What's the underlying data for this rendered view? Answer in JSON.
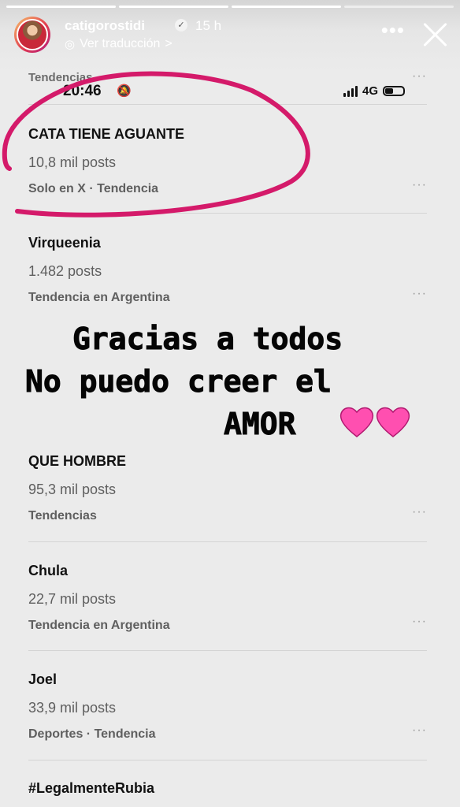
{
  "story": {
    "username": "catigorostidi",
    "time_ago": "15 h",
    "translate_label": "Ver traducción",
    "translate_chevron": ">",
    "more_icon": "more-horizontal-icon",
    "close_icon": "close-icon"
  },
  "statusbar": {
    "time": "20:46",
    "network": "4G",
    "silent_icon": "bell-slash-icon",
    "battery_fraction": 0.4
  },
  "x_trends": {
    "top_category": "Tendencias",
    "items": [
      {
        "name": "CATA TIENE AGUANTE",
        "count": "10,8 mil posts",
        "meta": "Solo en X · Tendencia"
      },
      {
        "name": "Virqueenia",
        "count": "1.482 posts",
        "meta": "Tendencia en Argentina"
      },
      {
        "name": "QUE HOMBRE",
        "count": "95,3 mil posts",
        "meta": "Tendencias"
      },
      {
        "name": "Chula",
        "count": "22,7 mil posts",
        "meta": "Tendencia en Argentina"
      },
      {
        "name": "Joel",
        "count": "33,9 mil posts",
        "meta": "Deportes · Tendencia"
      },
      {
        "name": "#LegalmenteRubia"
      }
    ],
    "more_dots": "···"
  },
  "overlay_text": {
    "line1": "Gracias a todos",
    "line2": "No puedo creer el",
    "line3": "AMOR"
  },
  "colors": {
    "annotation": "#d41a6a",
    "heart": "#ff4fb0"
  }
}
